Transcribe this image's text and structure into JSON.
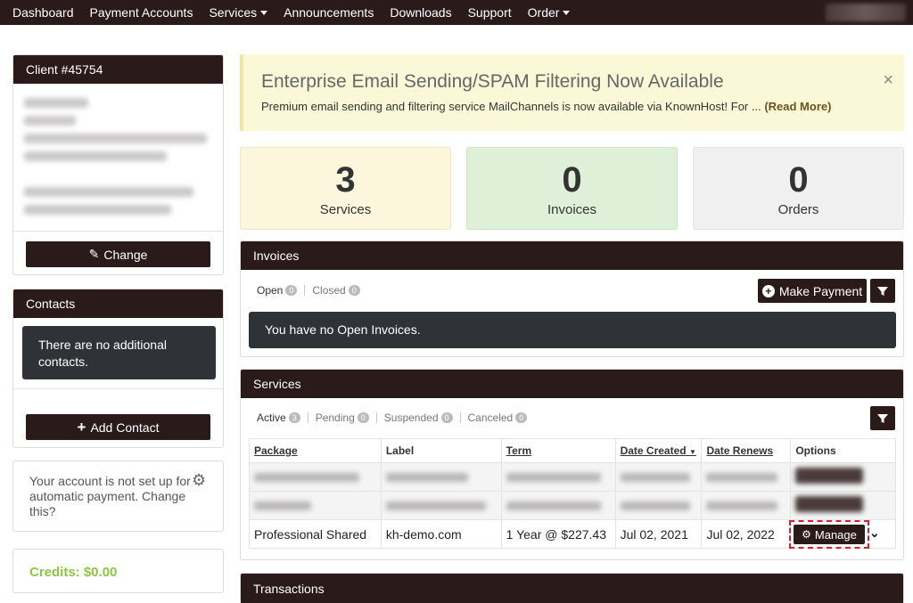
{
  "nav": {
    "items": [
      {
        "label": "Dashboard",
        "dropdown": false
      },
      {
        "label": "Payment Accounts",
        "dropdown": false
      },
      {
        "label": "Services",
        "dropdown": true
      },
      {
        "label": "Announcements",
        "dropdown": false
      },
      {
        "label": "Downloads",
        "dropdown": false
      },
      {
        "label": "Support",
        "dropdown": false
      },
      {
        "label": "Order",
        "dropdown": true
      }
    ]
  },
  "client": {
    "title": "Client #45754",
    "change_label": "Change"
  },
  "contacts": {
    "title": "Contacts",
    "empty_message": "There are no additional contacts.",
    "add_label": "Add Contact"
  },
  "autopay": {
    "message": "Your account is not set up for automatic payment. Change this?"
  },
  "credits": {
    "label": "Credits: $0.00"
  },
  "alert": {
    "title": "Enterprise Email Sending/SPAM Filtering Now Available",
    "text": "Premium email sending and filtering service MailChannels is now available via KnownHost! For ...",
    "read_more": "(Read More)",
    "close": "×"
  },
  "stats": [
    {
      "value": "3",
      "label": "Services"
    },
    {
      "value": "0",
      "label": "Invoices"
    },
    {
      "value": "0",
      "label": "Orders"
    }
  ],
  "invoices": {
    "title": "Invoices",
    "tabs": [
      {
        "label": "Open",
        "count": "0"
      },
      {
        "label": "Closed",
        "count": "0"
      }
    ],
    "make_payment_label": "Make Payment",
    "empty_message": "You have no Open Invoices."
  },
  "services": {
    "title": "Services",
    "tabs": [
      {
        "label": "Active",
        "count": "3"
      },
      {
        "label": "Pending",
        "count": "0"
      },
      {
        "label": "Suspended",
        "count": "0"
      },
      {
        "label": "Canceled",
        "count": "0"
      }
    ],
    "columns": [
      "Package",
      "Label",
      "Term",
      "Date Created",
      "Date Renews",
      "Options"
    ],
    "rows": [
      {
        "package": "Professional Shared",
        "label": "kh-demo.com",
        "term": "1 Year @ $227.43",
        "created": "Jul 02, 2021",
        "renews": "Jul 02, 2022",
        "action": "Manage"
      }
    ]
  },
  "transactions": {
    "title": "Transactions"
  },
  "colors": {
    "brand_dark": "#2b1a1a",
    "alert_bg": "#fbf8d7",
    "stat_services_bg": "#fbf6dc",
    "stat_invoices_bg": "#dff0d8",
    "stat_orders_bg": "#f0f0f0",
    "credits_green": "#8dc63f",
    "highlight_red": "#e0192e"
  }
}
